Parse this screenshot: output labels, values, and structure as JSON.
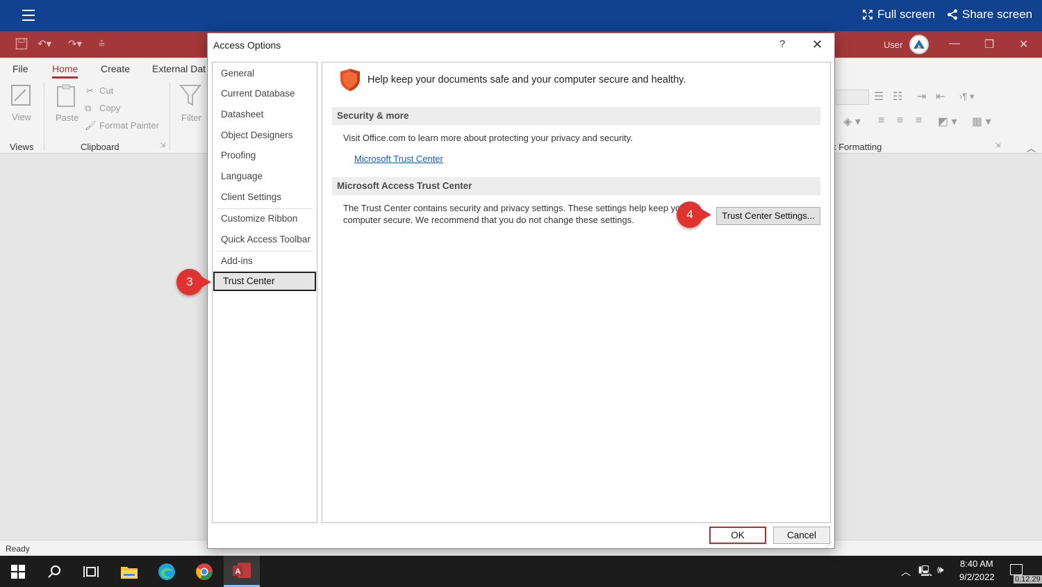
{
  "viewer": {
    "full_screen_label": "Full screen",
    "share_screen_label": "Share screen"
  },
  "access_titlebar": {
    "user_label": "User"
  },
  "ribbon": {
    "tabs": [
      "File",
      "Home",
      "Create",
      "External Dat"
    ],
    "active_tab": "Home",
    "views_group": {
      "view_label": "View",
      "group_label": "Views"
    },
    "clipboard_group": {
      "paste_label": "Paste",
      "cut_label": "Cut",
      "copy_label": "Copy",
      "format_painter_label": "Format Painter",
      "group_label": "Clipboard"
    },
    "filter_label": "Filter",
    "formatting_group_label": "t Formatting"
  },
  "status_bar": {
    "text": "Ready"
  },
  "dialog": {
    "title": "Access Options",
    "help_label": "?",
    "nav_items": [
      "General",
      "Current Database",
      "Datasheet",
      "Object Designers",
      "Proofing",
      "Language",
      "Client Settings",
      "Customize Ribbon",
      "Quick Access Toolbar",
      "Add-ins",
      "Trust Center"
    ],
    "selected_nav": "Trust Center",
    "intro_text": "Help keep your documents safe and your computer secure and healthy.",
    "security_section": {
      "heading": "Security & more",
      "text": "Visit Office.com to learn more about protecting your privacy and security.",
      "link": "Microsoft Trust Center"
    },
    "trust_center_section": {
      "heading": "Microsoft Access Trust Center",
      "text_line1": "The Trust Center contains security and privacy settings. These settings help keep yo",
      "text_line2": "computer secure. We recommend that you do not change these settings.",
      "button_label": "Trust Center Settings..."
    },
    "ok_label": "OK",
    "cancel_label": "Cancel"
  },
  "callouts": {
    "step3": "3",
    "step4": "4"
  },
  "taskbar": {
    "time": "8:40 AM",
    "date": "9/2/2022",
    "corner_badge": "0.12.29"
  },
  "colors": {
    "viewer_bar": "#10428f",
    "access_accent": "#a4373a",
    "callout": "#e0322f",
    "link": "#1e5aa8"
  }
}
